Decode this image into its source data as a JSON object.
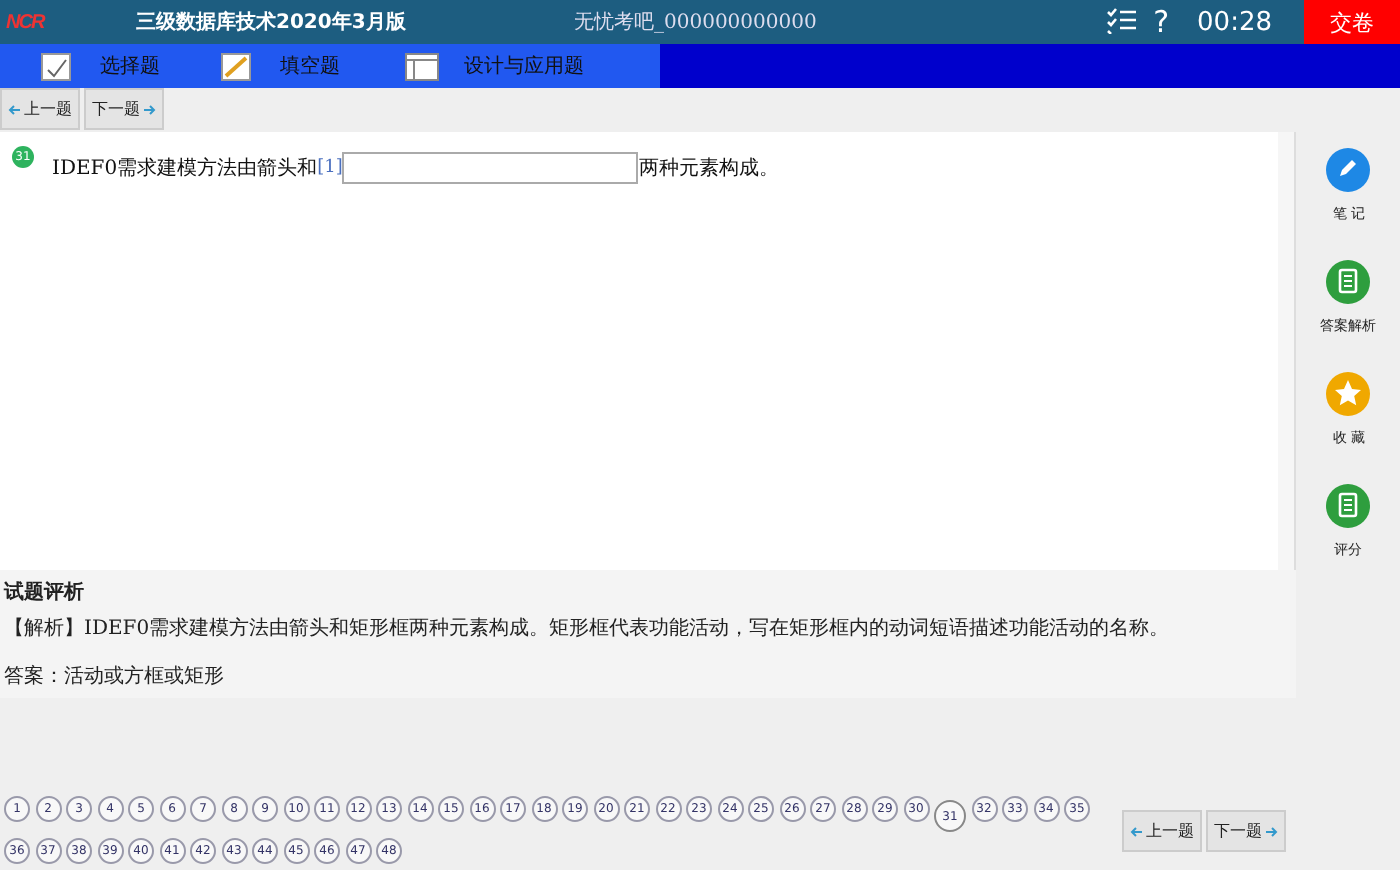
{
  "header": {
    "logo_text": "NCR",
    "app_title": "三级数据库技术2020年3月版",
    "exam_title": "无忧考吧_000000000000",
    "help": "?",
    "timer": "00:28",
    "submit": "交卷"
  },
  "tabs": [
    {
      "label": "选择题",
      "kind": "choice",
      "selected": false
    },
    {
      "label": "填空题",
      "kind": "fill",
      "selected": false
    },
    {
      "label": "设计与应用题",
      "kind": "design",
      "selected": false
    }
  ],
  "toolbar": {
    "prev": "上一题",
    "next": "下一题"
  },
  "question": {
    "number": "31",
    "text_before": "IDEF0需求建模方法由箭头和",
    "blank_label": "[1]",
    "text_after": "两种元素构成。"
  },
  "sidebar": [
    {
      "label": "笔 记",
      "kind": "pencil",
      "color": "#1e88e5"
    },
    {
      "label": "答案解析",
      "kind": "doc",
      "color": "#2e9e3e"
    },
    {
      "label": "收 藏",
      "kind": "star",
      "color": "#f0a800"
    },
    {
      "label": "评分",
      "kind": "doc",
      "color": "#2e9e3e"
    }
  ],
  "analysis": {
    "title": "试题评析",
    "explanation": "【解析】IDEF0需求建模方法由箭头和矩形框两种元素构成。矩形框代表功能活动，写在矩形框内的动词短语描述功能活动的名称。",
    "answer": "答案：活动或方框或矩形"
  },
  "question_nav": [
    {
      "label": "1",
      "selected": false
    },
    {
      "label": "2",
      "selected": false
    },
    {
      "label": "3",
      "selected": false
    },
    {
      "label": "4",
      "selected": false
    },
    {
      "label": "5",
      "selected": false
    },
    {
      "label": "6",
      "selected": false
    },
    {
      "label": "7",
      "selected": false
    },
    {
      "label": "8",
      "selected": false
    },
    {
      "label": "9",
      "selected": false
    },
    {
      "label": "10",
      "selected": false
    },
    {
      "label": "11",
      "selected": false
    },
    {
      "label": "12",
      "selected": false
    },
    {
      "label": "13",
      "selected": false
    },
    {
      "label": "14",
      "selected": false
    },
    {
      "label": "15",
      "selected": false
    },
    {
      "label": "16",
      "selected": false
    },
    {
      "label": "17",
      "selected": false
    },
    {
      "label": "18",
      "selected": false
    },
    {
      "label": "19",
      "selected": false
    },
    {
      "label": "20",
      "selected": false
    },
    {
      "label": "21",
      "selected": false
    },
    {
      "label": "22",
      "selected": false
    },
    {
      "label": "23",
      "selected": false
    },
    {
      "label": "24",
      "selected": false
    },
    {
      "label": "25",
      "selected": false
    },
    {
      "label": "26",
      "selected": false
    },
    {
      "label": "27",
      "selected": false
    },
    {
      "label": "28",
      "selected": false
    },
    {
      "label": "29",
      "selected": false
    },
    {
      "label": "30",
      "selected": false
    },
    {
      "label": "31",
      "selected": true
    },
    {
      "label": "32",
      "selected": false
    },
    {
      "label": "33",
      "selected": false
    },
    {
      "label": "34",
      "selected": false
    },
    {
      "label": "35",
      "selected": false
    },
    {
      "label": "36",
      "selected": false
    },
    {
      "label": "37",
      "selected": false
    },
    {
      "label": "38",
      "selected": false
    },
    {
      "label": "39",
      "selected": false
    },
    {
      "label": "40",
      "selected": false
    },
    {
      "label": "41",
      "selected": false
    },
    {
      "label": "42",
      "selected": false
    },
    {
      "label": "43",
      "selected": false
    },
    {
      "label": "44",
      "selected": false
    },
    {
      "label": "45",
      "selected": false
    },
    {
      "label": "46",
      "selected": false
    },
    {
      "label": "47",
      "selected": false
    },
    {
      "label": "48",
      "selected": false
    }
  ],
  "bottom_nav": {
    "prev": "上一题",
    "next": "下一题"
  }
}
